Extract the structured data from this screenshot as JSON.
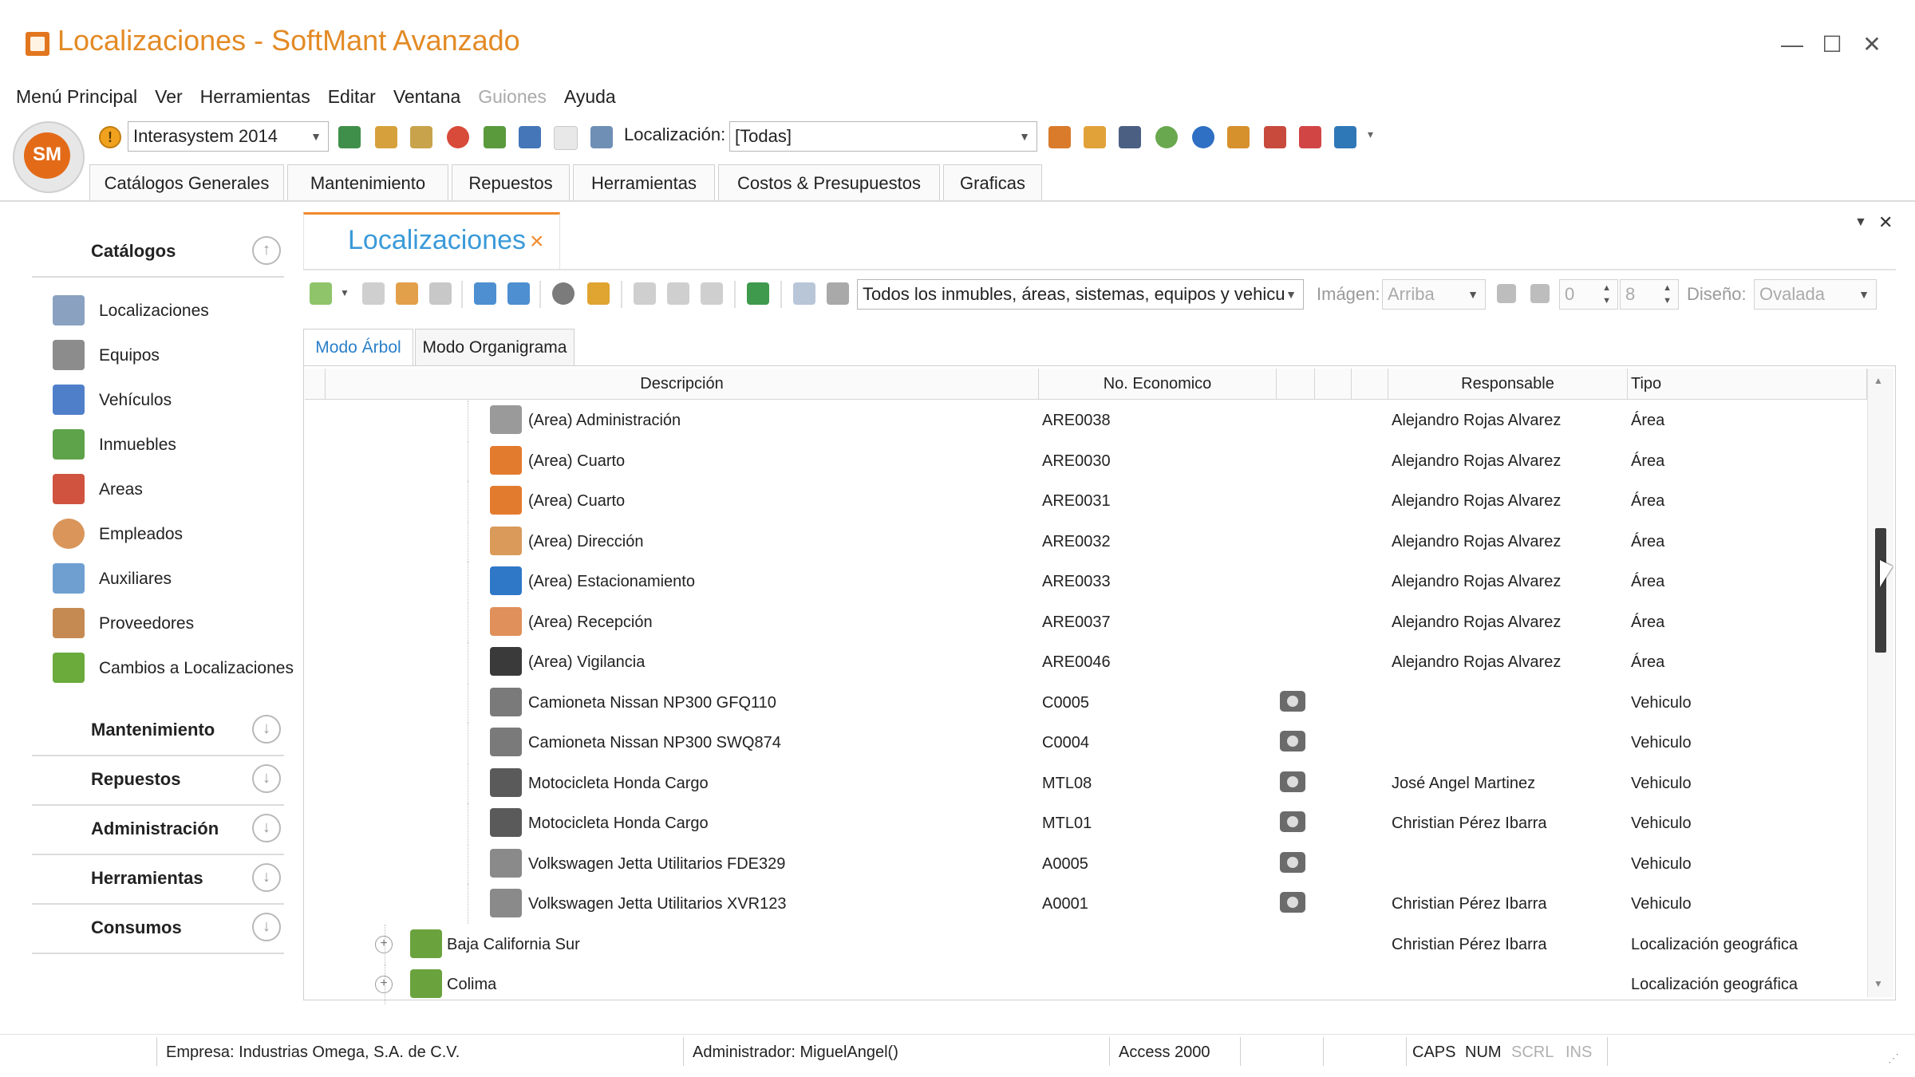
{
  "window": {
    "title": "Localizaciones - SoftMant  Avanzado",
    "minimize": "—",
    "maximize": "☐",
    "close": "✕"
  },
  "menu": [
    {
      "label": "Menú Principal",
      "enabled": true
    },
    {
      "label": "Ver",
      "enabled": true
    },
    {
      "label": "Herramientas",
      "enabled": true
    },
    {
      "label": "Editar",
      "enabled": true
    },
    {
      "label": "Ventana",
      "enabled": true
    },
    {
      "label": "Guiones",
      "enabled": false
    },
    {
      "label": "Ayuda",
      "enabled": true
    }
  ],
  "toolbar": {
    "company_combo": "Interasystem 2014",
    "localizacion_label": "Localización:",
    "localizacion_combo": "[Todas]"
  },
  "main_tabs": [
    "Catálogos Generales",
    "Mantenimiento",
    "Repuestos",
    "Herramientas",
    "Costos & Presupuestos",
    "Graficas"
  ],
  "sidebar": {
    "catalogos_header": "Catálogos",
    "items": [
      "Localizaciones",
      "Equipos",
      "Vehículos",
      "Inmuebles",
      "Areas",
      "Empleados",
      "Auxiliares",
      "Proveedores",
      "Cambios a Localizaciones"
    ],
    "sections": [
      "Mantenimiento",
      "Repuestos",
      "Administración",
      "Herramientas",
      "Consumos"
    ]
  },
  "document": {
    "tab_title": "Localizaciones",
    "tab_close": "×",
    "filter_combo": "Todos los inmubles, áreas, sistemas, equipos y vehicu",
    "imagen_label": "Imágen:",
    "imagen_combo": "Arriba",
    "spin1": "0",
    "spin2": "8",
    "diseno_label": "Diseño:",
    "diseno_combo": "Ovalada"
  },
  "sub_tabs": [
    "Modo Árbol",
    "Modo Organigrama"
  ],
  "grid": {
    "headers": {
      "descripcion": "Descripción",
      "no_economico": "No. Economico",
      "responsable": "Responsable",
      "tipo": "Tipo"
    },
    "rows": [
      {
        "desc": "(Area) Administración",
        "no": "ARE0038",
        "resp": "Alejandro Rojas Alvarez",
        "tipo": "Área",
        "icon": "calculator-icon",
        "photo": false
      },
      {
        "desc": "(Area) Cuarto",
        "no": "ARE0030",
        "resp": "Alejandro Rojas Alvarez",
        "tipo": "Área",
        "icon": "bed-icon",
        "photo": false
      },
      {
        "desc": "(Area) Cuarto",
        "no": "ARE0031",
        "resp": "Alejandro Rojas Alvarez",
        "tipo": "Área",
        "icon": "bed-icon",
        "photo": false
      },
      {
        "desc": "(Area) Dirección",
        "no": "ARE0032",
        "resp": "Alejandro Rojas Alvarez",
        "tipo": "Área",
        "icon": "people-icon",
        "photo": false
      },
      {
        "desc": "(Area) Estacionamiento",
        "no": "ARE0033",
        "resp": "Alejandro Rojas Alvarez",
        "tipo": "Área",
        "icon": "parking-icon",
        "photo": false
      },
      {
        "desc": "(Area) Recepción",
        "no": "ARE0037",
        "resp": "Alejandro Rojas Alvarez",
        "tipo": "Área",
        "icon": "receptionist-icon",
        "photo": false
      },
      {
        "desc": "(Area) Vigilancia",
        "no": "ARE0046",
        "resp": "Alejandro Rojas Alvarez",
        "tipo": "Área",
        "icon": "guard-icon",
        "photo": false
      },
      {
        "desc": "Camioneta Nissan NP300 GFQ110",
        "no": "C0005",
        "resp": "",
        "tipo": "Vehiculo",
        "icon": "truck-icon",
        "photo": true
      },
      {
        "desc": "Camioneta Nissan NP300 SWQ874",
        "no": "C0004",
        "resp": "",
        "tipo": "Vehiculo",
        "icon": "truck-icon",
        "photo": true
      },
      {
        "desc": "Motocicleta Honda Cargo",
        "no": "MTL08",
        "resp": "José Angel Martinez",
        "tipo": "Vehiculo",
        "icon": "motorcycle-icon",
        "photo": true
      },
      {
        "desc": "Motocicleta Honda Cargo",
        "no": "MTL01",
        "resp": "Christian Pérez Ibarra",
        "tipo": "Vehiculo",
        "icon": "motorcycle-icon",
        "photo": true
      },
      {
        "desc": "Volkswagen Jetta Utilitarios FDE329",
        "no": "A0005",
        "resp": "",
        "tipo": "Vehiculo",
        "icon": "car-icon",
        "photo": true
      },
      {
        "desc": "Volkswagen Jetta Utilitarios XVR123",
        "no": "A0001",
        "resp": "Christian Pérez Ibarra",
        "tipo": "Vehiculo",
        "icon": "car-icon",
        "photo": true
      },
      {
        "desc": "Baja California Sur",
        "no": "",
        "resp": "Christian Pérez Ibarra",
        "tipo": "Localización geográfica",
        "icon": "map-icon",
        "photo": false
      },
      {
        "desc": "Colima",
        "no": "",
        "resp": "",
        "tipo": "Localización geográfica",
        "icon": "map-icon",
        "photo": false
      }
    ]
  },
  "status": {
    "empresa": "Empresa: Industrias Omega, S.A. de C.V.",
    "administrador": "Administrador: MiguelAngel()",
    "db": "Access 2000",
    "caps": "CAPS",
    "num": "NUM",
    "scrl": "SCRL",
    "ins": "INS"
  },
  "colors": {
    "accent_orange": "#e38a25",
    "tab_blue": "#3a9ad9",
    "active_subtab": "#2a7fc8"
  }
}
